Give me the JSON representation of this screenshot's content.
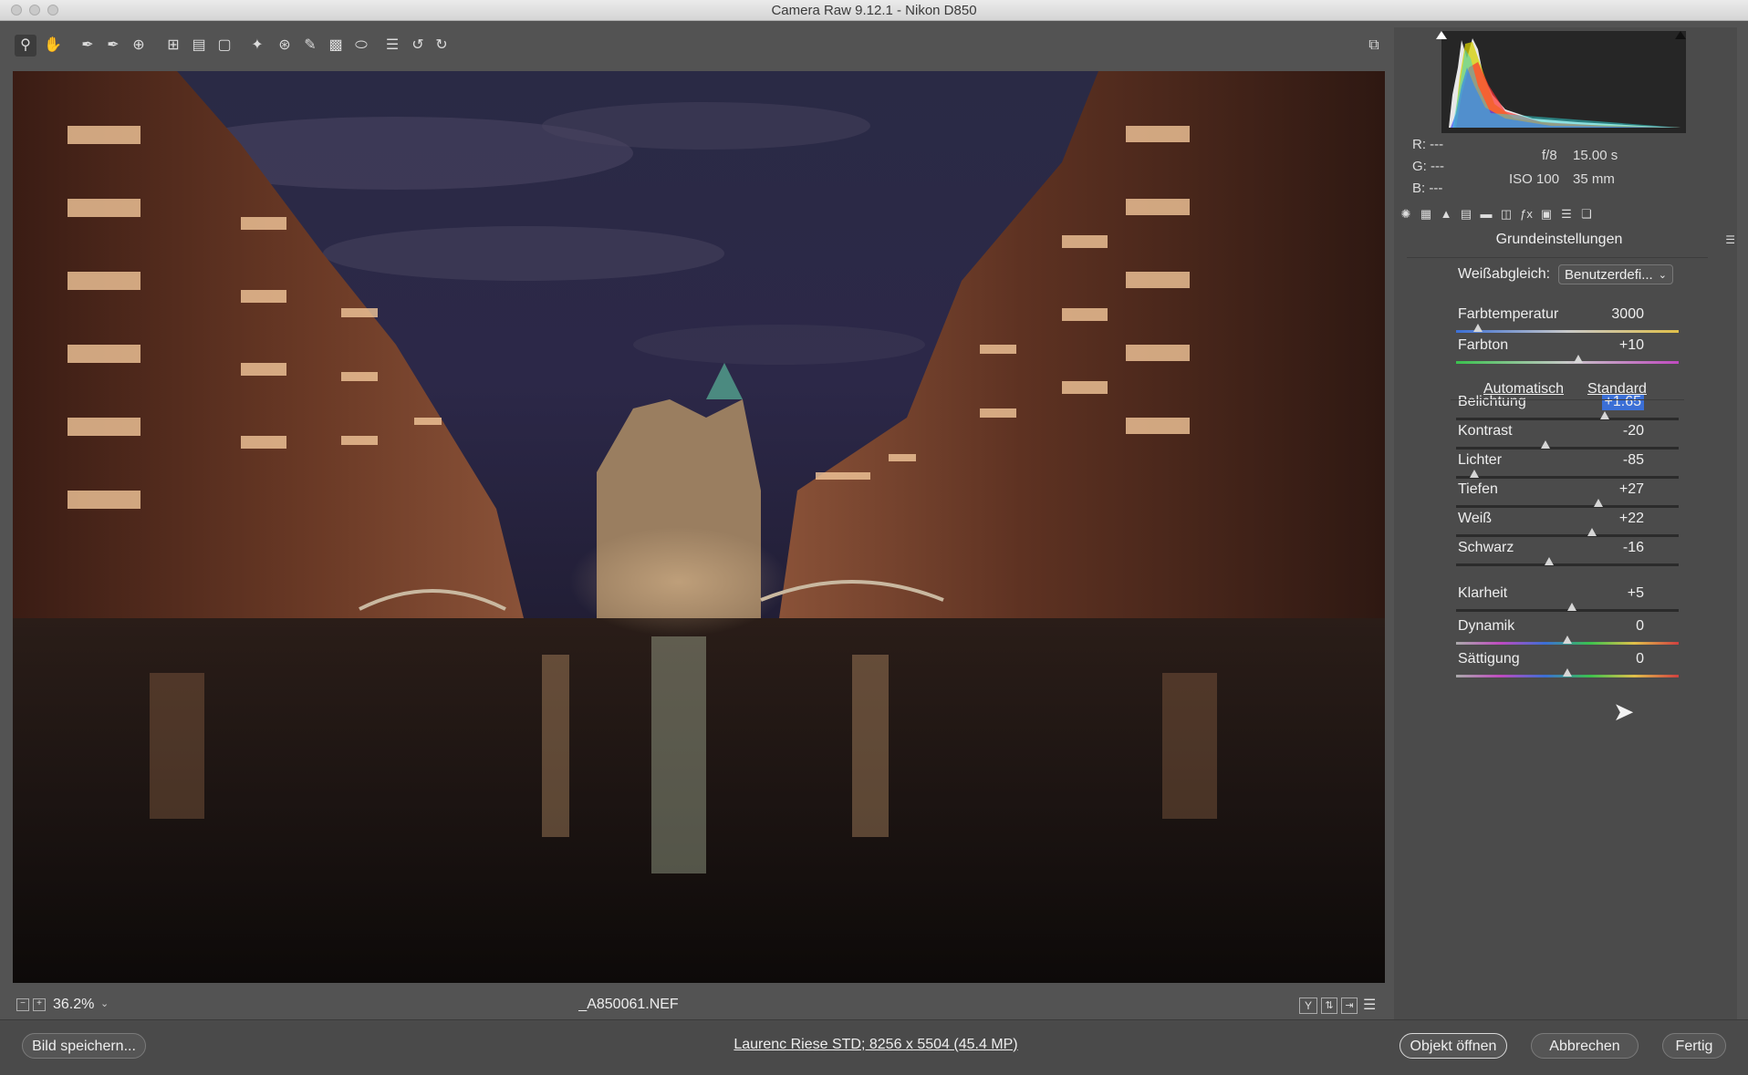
{
  "window": {
    "title": "Camera Raw 9.12.1  -  Nikon D850"
  },
  "toolbar": {
    "tools": [
      "zoom-tool",
      "hand-tool",
      "white-balance-tool",
      "color-sampler-tool",
      "targeted-adjustment-tool",
      "crop-tool",
      "straighten-tool",
      "transform-tool",
      "spot-removal-tool",
      "red-eye-tool",
      "adjustment-brush-tool",
      "graduated-filter-tool",
      "radial-filter-tool",
      "presets-tool",
      "rotate-left-tool",
      "rotate-right-tool"
    ]
  },
  "status": {
    "zoom": "36.2%",
    "filename": "_A850061.NEF"
  },
  "footer": {
    "save_label": "Bild speichern...",
    "workflow_link": "Laurenc Riese STD; 8256 x 5504 (45.4 MP)",
    "open_label": "Objekt öffnen",
    "cancel_label": "Abbrechen",
    "done_label": "Fertig"
  },
  "histogram": {
    "r": "R:",
    "r_val": "---",
    "g": "G:",
    "g_val": "---",
    "b": "B:",
    "b_val": "---",
    "aperture": "f/8",
    "shutter": "15.00 s",
    "iso": "ISO 100",
    "focal": "35 mm"
  },
  "panel": {
    "title": "Grundeinstellungen",
    "wb_label": "Weißabgleich:",
    "wb_value": "Benutzerdefi...",
    "auto_label": "Automatisch",
    "default_label": "Standard",
    "sliders": [
      {
        "label": "Farbtemperatur",
        "value": "3000",
        "pos": 0.1
      },
      {
        "label": "Farbton",
        "value": "+10",
        "pos": 0.55
      },
      {
        "label": "Belichtung",
        "value": "+1.65",
        "pos": 0.67
      },
      {
        "label": "Kontrast",
        "value": "-20",
        "pos": 0.4
      },
      {
        "label": "Lichter",
        "value": "-85",
        "pos": 0.08
      },
      {
        "label": "Tiefen",
        "value": "+27",
        "pos": 0.64
      },
      {
        "label": "Weiß",
        "value": "+22",
        "pos": 0.61
      },
      {
        "label": "Schwarz",
        "value": "-16",
        "pos": 0.42
      },
      {
        "label": "Klarheit",
        "value": "+5",
        "pos": 0.52
      },
      {
        "label": "Dynamik",
        "value": "0",
        "pos": 0.5
      },
      {
        "label": "Sättigung",
        "value": "0",
        "pos": 0.5
      }
    ]
  },
  "colors": {
    "accent": "#3b6fd6",
    "bg": "#535353",
    "panel": "#4b4b4b"
  }
}
